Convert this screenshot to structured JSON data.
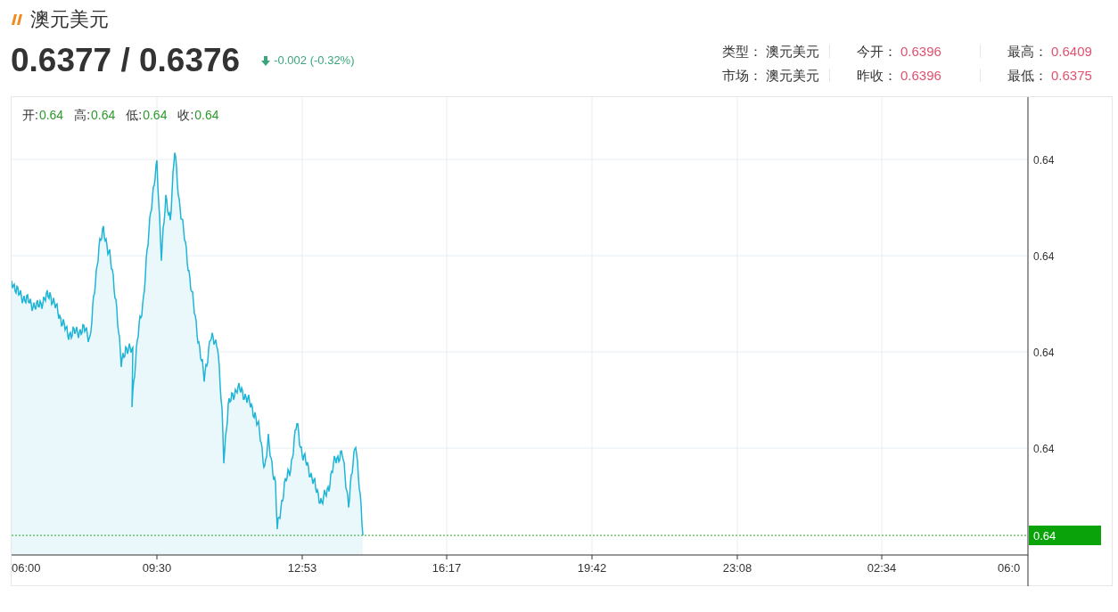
{
  "title": "澳元美元",
  "quote": {
    "price": "0.6377 / 0.6376",
    "falling": true,
    "change": "-0.002 (-0.32%)"
  },
  "info": [
    [
      {
        "label": "类型：",
        "value": "澳元美元",
        "kind": "text"
      },
      {
        "label": "今开：",
        "value": "0.6396",
        "kind": "price"
      },
      {
        "label": "最高：",
        "value": "0.6409",
        "kind": "price"
      }
    ],
    [
      {
        "label": "市场：",
        "value": "澳元美元",
        "kind": "text"
      },
      {
        "label": "昨收：",
        "value": "0.6396",
        "kind": "price"
      },
      {
        "label": "最低：",
        "value": "0.6375",
        "kind": "price"
      }
    ]
  ],
  "chart": {
    "legend": [
      {
        "label": "开:",
        "value": "0.64"
      },
      {
        "label": "高:",
        "value": "0.64"
      },
      {
        "label": "低:",
        "value": "0.64"
      },
      {
        "label": "收:",
        "value": "0.64"
      }
    ],
    "y_labels": [
      "0.64",
      "0.64",
      "0.64",
      "0.64"
    ],
    "x_labels": [
      "06:00",
      "09:30",
      "12:53",
      "16:17",
      "19:42",
      "23:08",
      "02:34",
      "06:0"
    ],
    "current_price": "0.64"
  }
}
